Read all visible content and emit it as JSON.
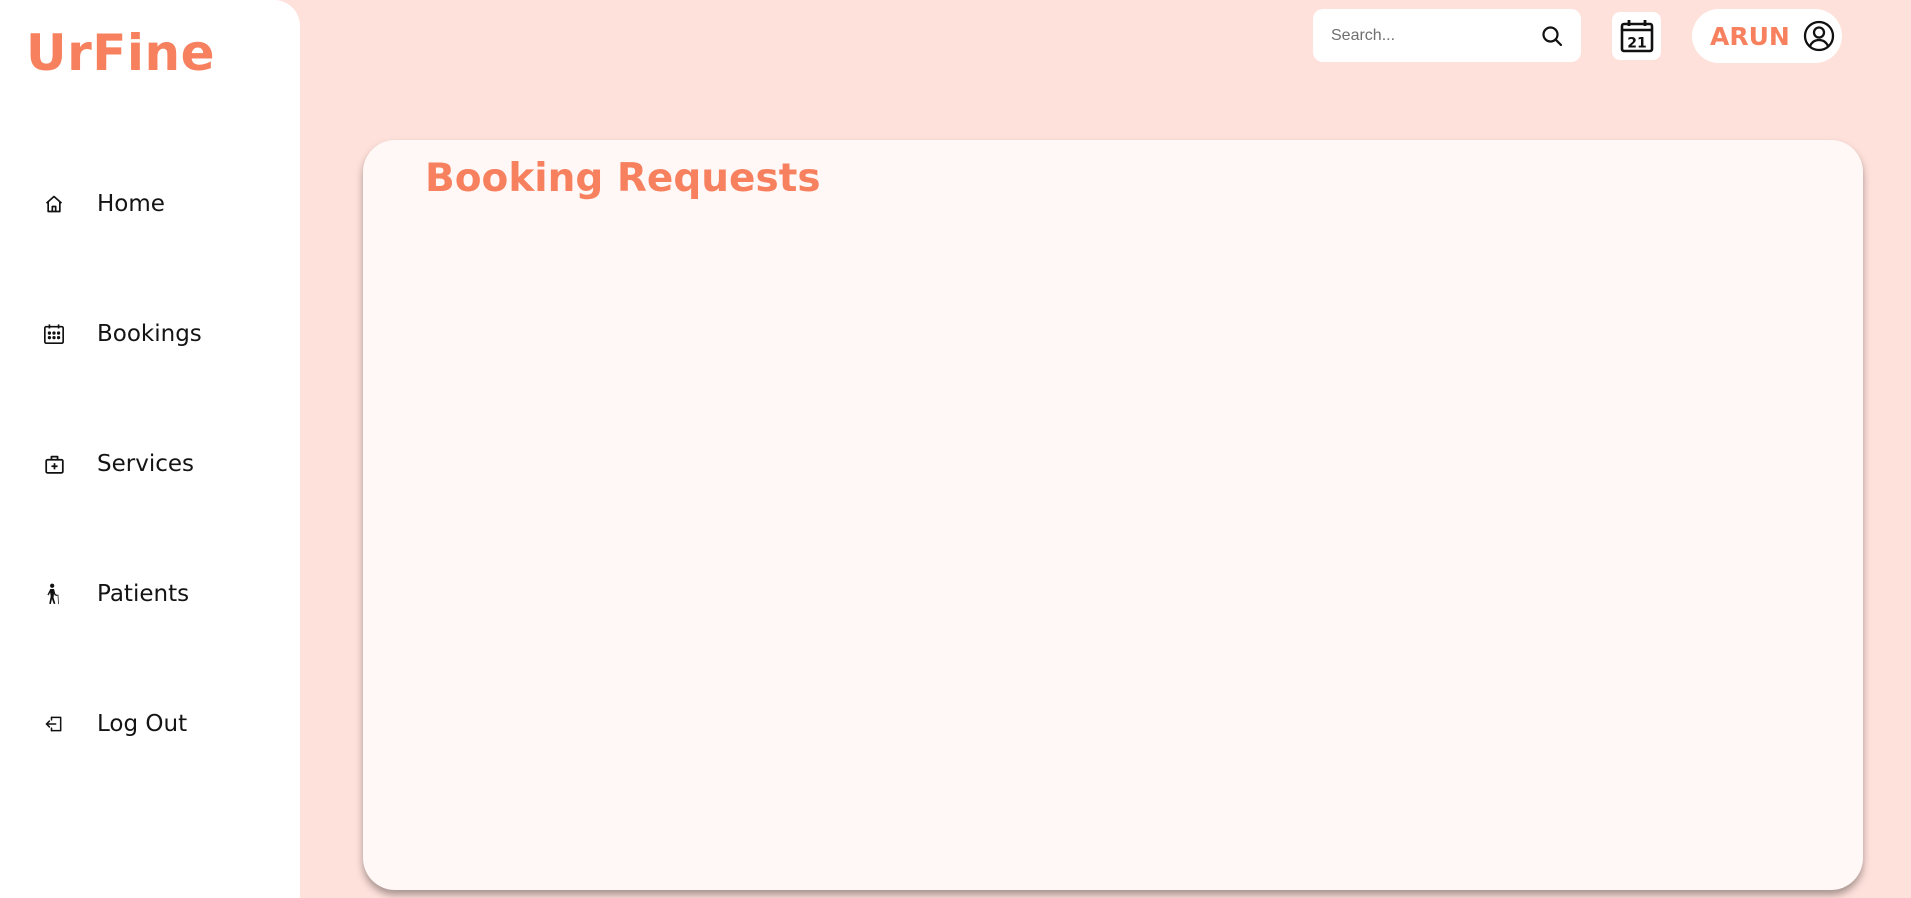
{
  "brand": {
    "name": "UrFine"
  },
  "sidebar": {
    "items": [
      {
        "label": "Home",
        "icon": "home-icon"
      },
      {
        "label": "Bookings",
        "icon": "calendar-grid-icon"
      },
      {
        "label": "Services",
        "icon": "medical-bag-icon"
      },
      {
        "label": "Patients",
        "icon": "elderly-person-icon"
      },
      {
        "label": "Log Out",
        "icon": "logout-icon"
      }
    ]
  },
  "header": {
    "search": {
      "placeholder": "Search...",
      "value": ""
    },
    "calendar_day": "21",
    "user_name": "ARUN"
  },
  "main": {
    "title": "Booking Requests"
  },
  "colors": {
    "accent": "#f7805f",
    "background": "#ffe1db",
    "panel": "#fff8f6",
    "surface": "#ffffff"
  }
}
